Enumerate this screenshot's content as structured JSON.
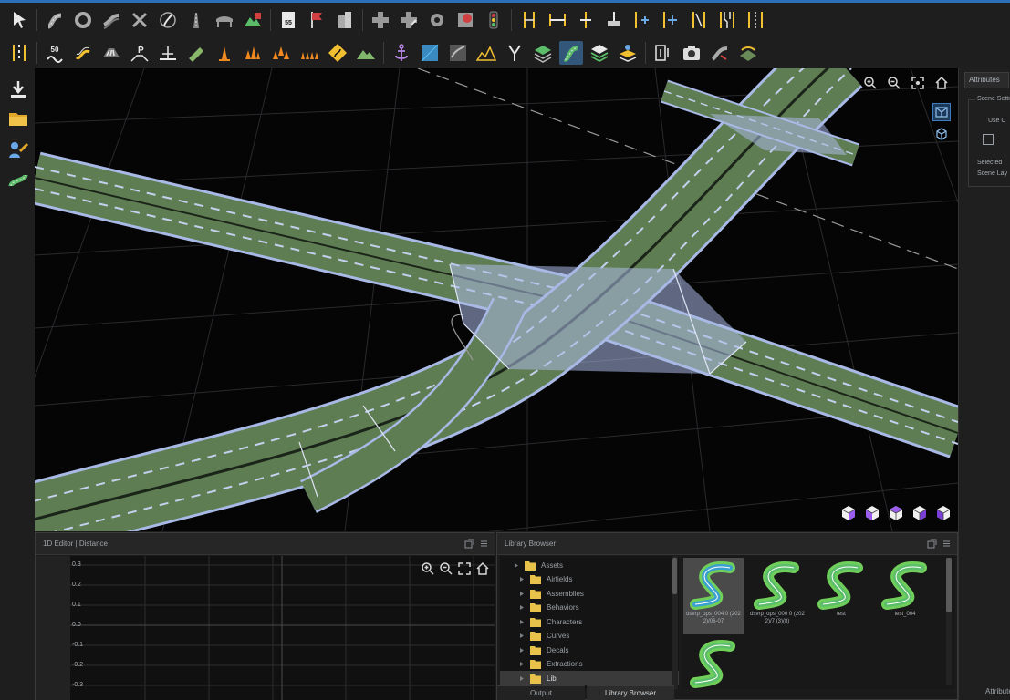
{
  "toolbar_top": {
    "tools": [
      {
        "icon": "select-arrow-icon"
      },
      {
        "icon": "curve-road-icon"
      },
      {
        "icon": "circle-road-icon"
      },
      {
        "icon": "parametric-road-icon"
      },
      {
        "icon": "road-network-icon"
      },
      {
        "icon": "globe-road-icon"
      },
      {
        "icon": "highway-icon"
      },
      {
        "icon": "bridge-icon"
      },
      {
        "icon": "terrain-paint-icon"
      },
      {
        "icon": "speed-limit-sign-icon",
        "text": "55"
      },
      {
        "icon": "flag-marker-icon"
      },
      {
        "icon": "building-icon"
      },
      {
        "icon": "junction-icon"
      },
      {
        "icon": "junction-edit-icon"
      },
      {
        "icon": "roundabout-icon"
      },
      {
        "icon": "stop-junction-icon"
      },
      {
        "icon": "traffic-light-icon"
      },
      {
        "icon": "lane-width-icon"
      },
      {
        "icon": "lane-span-icon"
      },
      {
        "icon": "lane-center-icon"
      },
      {
        "icon": "lane-shift-icon"
      },
      {
        "icon": "lane-add-icon"
      },
      {
        "icon": "lane-add-right-icon"
      },
      {
        "icon": "lane-form-icon"
      },
      {
        "icon": "lane-merge-icon"
      },
      {
        "icon": "lane-split-icon"
      }
    ]
  },
  "toolbar_bottom": {
    "tools": [
      {
        "icon": "lane-marking-icon"
      },
      {
        "icon": "speed-50-icon",
        "text": "50"
      },
      {
        "icon": "s-curve-yellow-icon"
      },
      {
        "icon": "crosswalk-icon"
      },
      {
        "icon": "parking-icon"
      },
      {
        "icon": "barrier-icon"
      },
      {
        "icon": "prop-paint-icon"
      },
      {
        "icon": "cone-icon"
      },
      {
        "icon": "cone-group-icon"
      },
      {
        "icon": "cone-scatter-icon"
      },
      {
        "icon": "cone-row-icon"
      },
      {
        "icon": "diamond-sign-icon"
      },
      {
        "icon": "terrain-icon"
      },
      {
        "icon": "anchor-icon"
      },
      {
        "icon": "material-icon"
      },
      {
        "icon": "texture-icon"
      },
      {
        "icon": "elevation-icon"
      },
      {
        "icon": "split-path-icon"
      },
      {
        "icon": "layer-road-icon"
      },
      {
        "icon": "layer-road-active-icon",
        "active": true
      },
      {
        "icon": "layer-stack-icon"
      },
      {
        "icon": "layer-pin-icon"
      },
      {
        "icon": "export-scene-icon"
      },
      {
        "icon": "camera-icon"
      },
      {
        "icon": "road-preview-icon"
      },
      {
        "icon": "library-road-icon"
      }
    ]
  },
  "left_dock": {
    "items": [
      {
        "icon": "import-download-icon"
      },
      {
        "icon": "folder-icon"
      },
      {
        "icon": "scenario-person-icon"
      },
      {
        "icon": "road-switch-icon"
      }
    ]
  },
  "viewport": {
    "tools": [
      "zoom-in-icon",
      "zoom-out-icon",
      "fit-view-icon",
      "home-view-icon"
    ],
    "view_modes": [
      "perspective-view-icon",
      "3d-cube-view-icon"
    ],
    "orientation_cubes": [
      "cube-view-1-icon",
      "cube-view-2-icon",
      "cube-view-3-icon",
      "cube-view-4-icon",
      "cube-view-5-icon"
    ],
    "colors": {
      "road": "#5f7d52",
      "lane_line": "#a9b9e6",
      "grid": "#2c2c30",
      "background": "#050505"
    }
  },
  "attributes_panel": {
    "tab": "Attributes",
    "group": "Scene Settings",
    "option_label": "Use C",
    "rows": [
      "Selected",
      "Scene Lay"
    ],
    "bottom_tab": "Attributes"
  },
  "curve_editor": {
    "title": "1D Editor | Distance",
    "y_ticks": [
      "0.3",
      "0.2",
      "0.1",
      "0.0",
      "-0.1",
      "-0.2",
      "-0.3"
    ],
    "tools": [
      "zoom-in-icon",
      "zoom-out-icon",
      "fit-view-icon",
      "home-view-icon"
    ]
  },
  "library_browser": {
    "title": "Library Browser",
    "tree": [
      {
        "label": "Assets",
        "level": 0
      },
      {
        "label": "Airfields",
        "level": 1
      },
      {
        "label": "Assemblies",
        "level": 1
      },
      {
        "label": "Behaviors",
        "level": 1
      },
      {
        "label": "Characters",
        "level": 1
      },
      {
        "label": "Curves",
        "level": 1
      },
      {
        "label": "Decals",
        "level": 1
      },
      {
        "label": "Extractions",
        "level": 1
      },
      {
        "label": "Lib",
        "level": 1,
        "selected": true
      }
    ],
    "assets": [
      {
        "label": "dsvrp_ops_004 0 (2022)/06-07",
        "selected": true
      },
      {
        "label": "dsvrp_ops_000 0 (2022)/7 (3)(8)",
        "selected": false
      },
      {
        "label": "test",
        "selected": false
      },
      {
        "label": "test_004",
        "selected": false
      },
      {
        "label": "",
        "selected": false
      }
    ],
    "tabs": [
      {
        "label": "Output",
        "active": false
      },
      {
        "label": "Library Browser",
        "active": true
      }
    ]
  }
}
